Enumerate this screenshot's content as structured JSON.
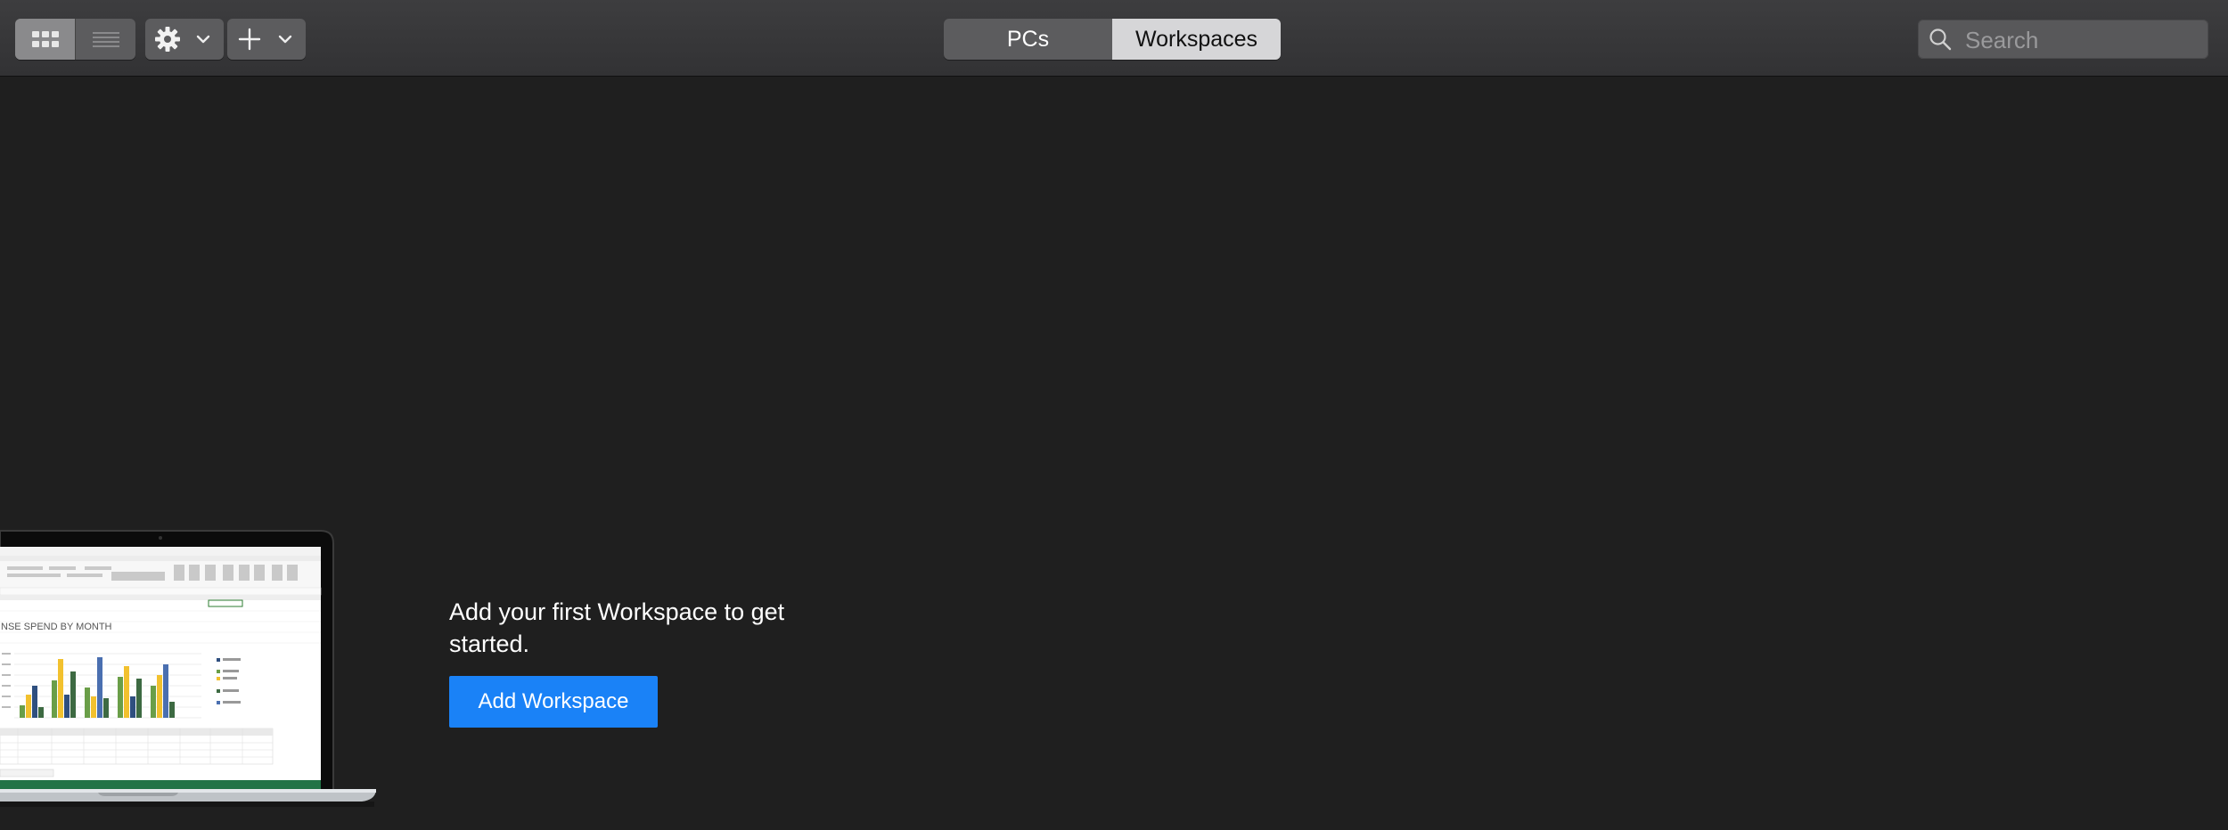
{
  "toolbar": {
    "view_modes": [
      {
        "name": "grid-view",
        "icon": "grid-icon",
        "selected": true
      },
      {
        "name": "list-view",
        "icon": "list-icon",
        "selected": false
      }
    ],
    "settings_icon": "gear-icon",
    "add_icon": "plus-icon",
    "tabs": [
      {
        "label": "PCs",
        "selected": false
      },
      {
        "label": "Workspaces",
        "selected": true
      }
    ],
    "search": {
      "placeholder": "Search",
      "value": ""
    }
  },
  "empty_state": {
    "message": "Add your first Workspace to get started.",
    "button_label": "Add Workspace"
  },
  "illustration": {
    "sheet_title": "NSE SPEND BY MONTH"
  },
  "colors": {
    "accent": "#1a82f7",
    "background": "#1f1f1f",
    "toolbar": "#38383a"
  }
}
